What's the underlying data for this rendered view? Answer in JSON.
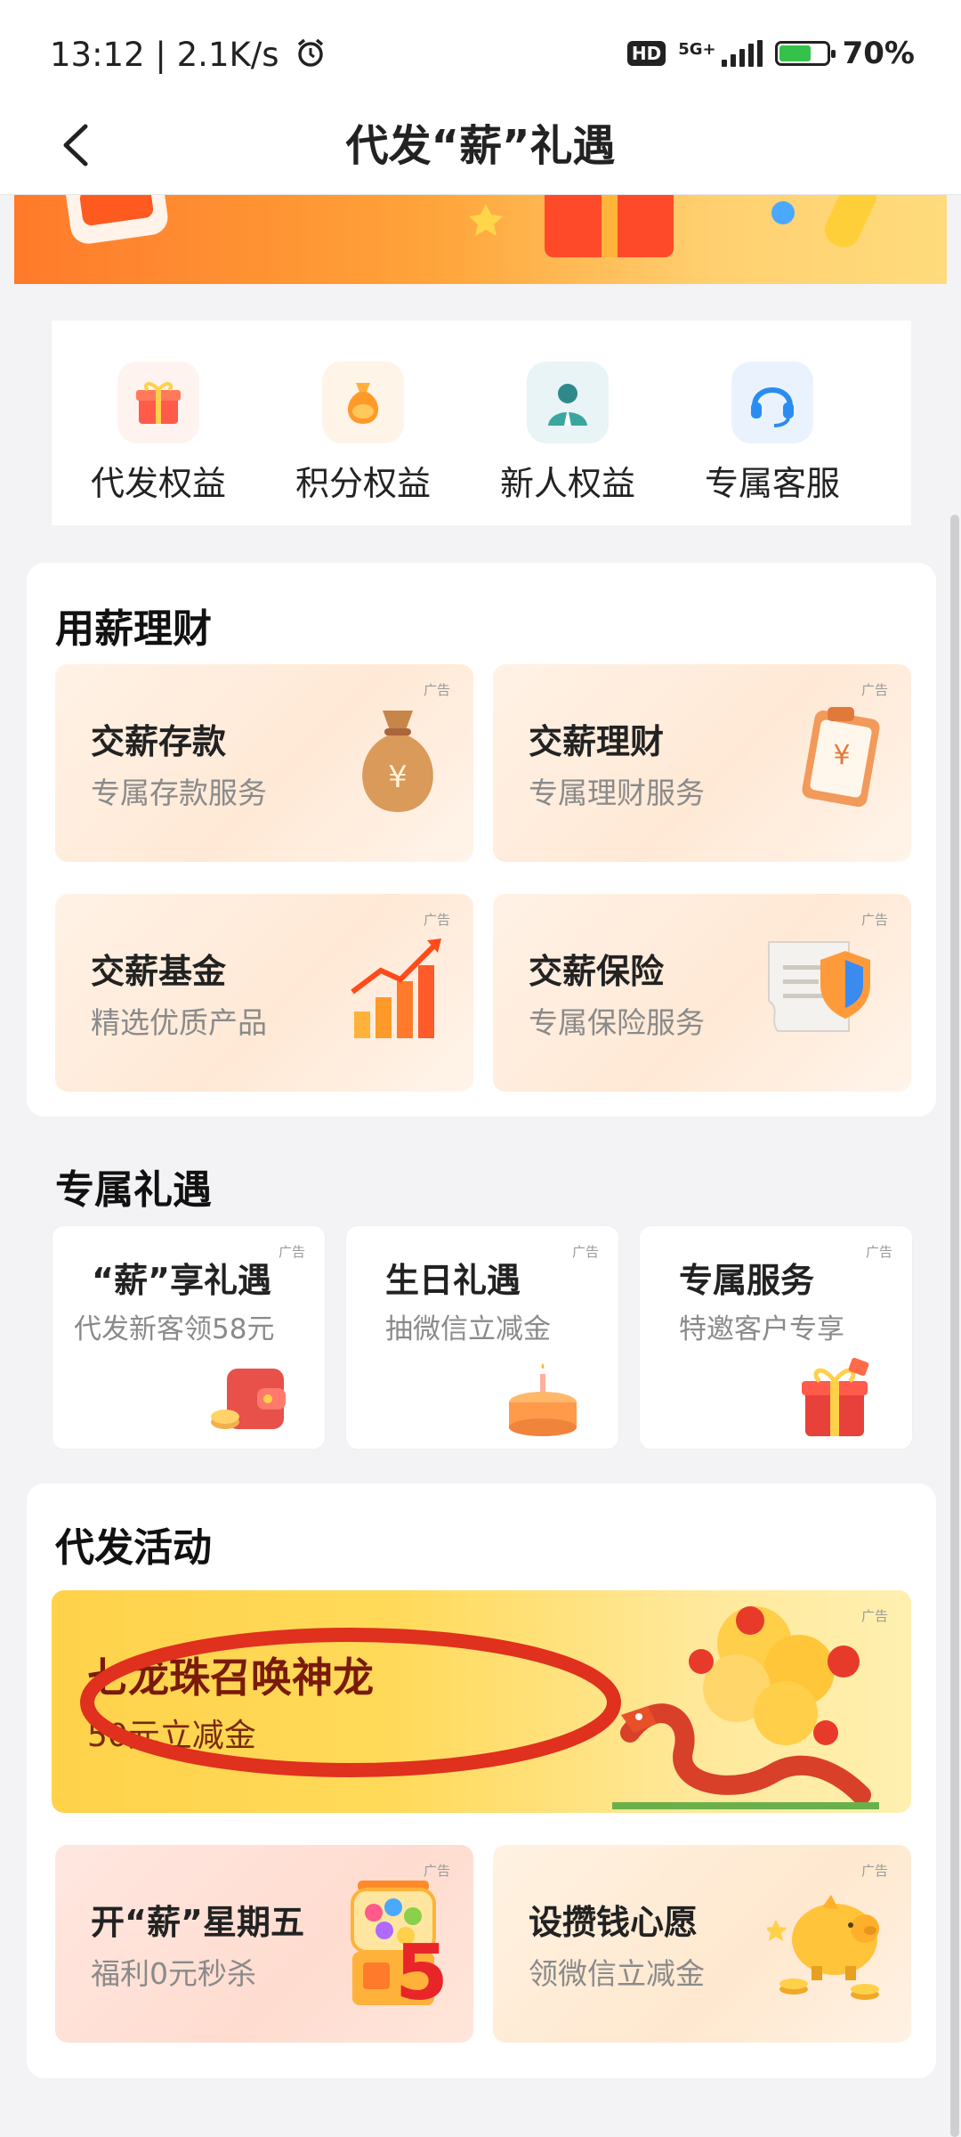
{
  "status_bar": {
    "time": "13:12",
    "network_speed": "2.1K/s",
    "hd_label": "HD",
    "network_type": "5G+",
    "battery_percent": "70%",
    "battery_level": 0.7
  },
  "nav": {
    "title": "代发“薪”礼遇"
  },
  "quick_menu": [
    {
      "label": "代发权益",
      "icon": "gift-box-icon"
    },
    {
      "label": "积分权益",
      "icon": "money-bag-icon"
    },
    {
      "label": "新人权益",
      "icon": "person-icon"
    },
    {
      "label": "专属客服",
      "icon": "headset-icon"
    }
  ],
  "finance": {
    "title": "用薪理财",
    "cards": [
      {
        "title": "交薪存款",
        "subtitle": "专属存款服务",
        "ad": "广告",
        "icon": "money-bag-icon"
      },
      {
        "title": "交薪理财",
        "subtitle": "专属理财服务",
        "ad": "广告",
        "icon": "clipboard-yuan-icon"
      },
      {
        "title": "交薪基金",
        "subtitle": "精选优质产品",
        "ad": "广告",
        "icon": "rising-chart-icon"
      },
      {
        "title": "交薪保险",
        "subtitle": "专属保险服务",
        "ad": "广告",
        "icon": "shield-document-icon"
      }
    ]
  },
  "gifts": {
    "title": "专属礼遇",
    "cards": [
      {
        "title": "“薪”享礼遇",
        "subtitle": "代发新客领58元",
        "ad": "广告",
        "icon": "wallet-icon"
      },
      {
        "title": "生日礼遇",
        "subtitle": "抽微信立减金",
        "ad": "广告",
        "icon": "birthday-cake-icon"
      },
      {
        "title": "专属服务",
        "subtitle": "特邀客户专享",
        "ad": "广告",
        "icon": "gift-box-icon"
      }
    ]
  },
  "activities": {
    "title": "代发活动",
    "banner": {
      "title": "七龙珠召唤神龙",
      "subtitle": "50元立减金",
      "ad": "广告",
      "icon": "dragon-icon"
    },
    "cards": [
      {
        "title": "开“薪”星期五",
        "subtitle": "福利0元秒杀",
        "ad": "广告",
        "icon": "gumball-machine-icon",
        "badge": "5"
      },
      {
        "title": "设攒钱心愿",
        "subtitle": "领微信立减金",
        "ad": "广告",
        "icon": "piggy-bank-icon"
      }
    ]
  },
  "colors": {
    "accent": "#ff8a2b",
    "annotation_red": "#e0301e"
  }
}
